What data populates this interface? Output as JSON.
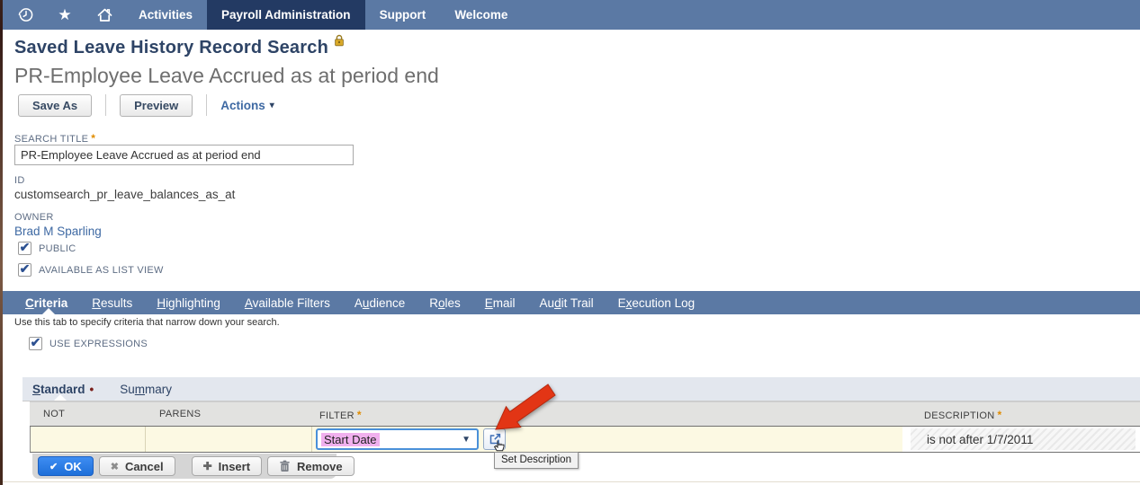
{
  "nav": {
    "items": [
      {
        "label": "Activities",
        "active": false
      },
      {
        "label": "Payroll Administration",
        "active": true
      },
      {
        "label": "Support",
        "active": false
      },
      {
        "label": "Welcome",
        "active": false
      }
    ]
  },
  "header": {
    "title": "Saved Leave History Record Search",
    "subtitle": "PR-Employee Leave Accrued as at period end"
  },
  "toolbar": {
    "save_as_label": "Save As",
    "preview_label": "Preview",
    "actions_label": "Actions"
  },
  "form": {
    "search_title_label": "SEARCH TITLE",
    "search_title_value": "PR-Employee Leave Accrued as at period end",
    "id_label": "ID",
    "id_value": "customsearch_pr_leave_balances_as_at",
    "owner_label": "OWNER",
    "owner_value": "Brad M Sparling",
    "public_label": "PUBLIC",
    "available_label": "AVAILABLE AS LIST VIEW",
    "use_expressions_label": "USE EXPRESSIONS"
  },
  "tabs": {
    "hint": "Use this tab to specify criteria that narrow down your search.",
    "items": [
      {
        "pre": "",
        "u": "C",
        "post": "riteria",
        "active": true
      },
      {
        "pre": "",
        "u": "R",
        "post": "esults",
        "active": false
      },
      {
        "pre": "",
        "u": "H",
        "post": "ighlighting",
        "active": false
      },
      {
        "pre": "",
        "u": "A",
        "post": "vailable Filters",
        "active": false
      },
      {
        "pre": "A",
        "u": "u",
        "post": "dience",
        "active": false
      },
      {
        "pre": "R",
        "u": "o",
        "post": "les",
        "active": false
      },
      {
        "pre": "",
        "u": "E",
        "post": "mail",
        "active": false
      },
      {
        "pre": "Au",
        "u": "d",
        "post": "it Trail",
        "active": false
      },
      {
        "pre": "E",
        "u": "x",
        "post": "ecution Log",
        "active": false
      }
    ]
  },
  "subtabs": {
    "standard": {
      "pre": "",
      "u": "S",
      "post": "tandard"
    },
    "summary": {
      "pre": "Su",
      "u": "m",
      "post": "mary"
    }
  },
  "criteria_table": {
    "headers": {
      "not": "NOT",
      "parens": "PARENS",
      "filter": "FILTER",
      "description": "DESCRIPTION"
    },
    "row": {
      "filter_value": "Start Date",
      "description": "is not after 1/7/2011"
    }
  },
  "tooltip": {
    "set_description": "Set Description"
  },
  "footer_buttons": {
    "ok": "OK",
    "cancel": "Cancel",
    "insert": "Insert",
    "remove": "Remove"
  },
  "misc": {
    "required_marker": "*"
  },
  "icons": {
    "star": "★",
    "caret_down_small": "▾",
    "caret_down": "▼",
    "check": "✔",
    "cross": "✖",
    "plus": "✚",
    "dot": "•"
  },
  "colors": {
    "nav_bar": "#5b79a4",
    "nav_active": "#233a63",
    "tab_bar": "#5b79a4",
    "title_navy": "#2e4466",
    "link_blue": "#3e69a3",
    "ok_button_blue": "#2478e8",
    "row_yellow": "#fcf9e3",
    "selection_pink": "#f0b0ee",
    "required_orange": "#e08c00",
    "arrow_red": "#e23515"
  }
}
